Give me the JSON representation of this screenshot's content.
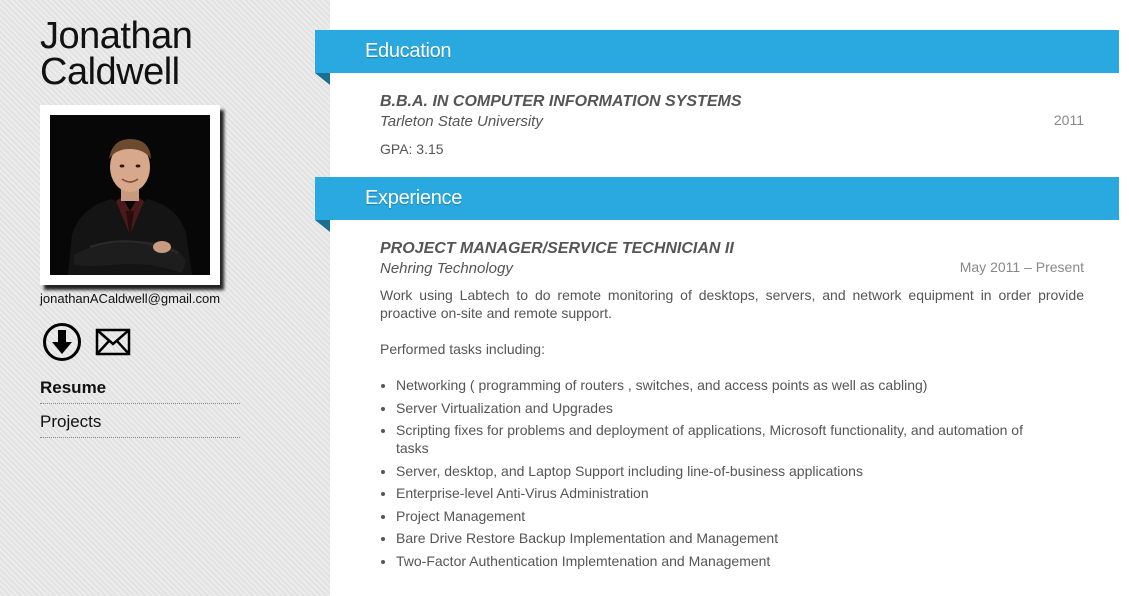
{
  "sidebar": {
    "name_first": "Jonathan",
    "name_last": "Caldwell",
    "email": "jonathanACaldwell@gmail.com",
    "icons": {
      "download": "download-icon",
      "mail": "mail-icon"
    },
    "nav": [
      {
        "label": "Resume",
        "active": true
      },
      {
        "label": "Projects",
        "active": false
      }
    ]
  },
  "education": {
    "heading": "Education",
    "degree": "B.B.A. IN COMPUTER INFORMATION SYSTEMS",
    "school": "Tarleton State University",
    "year": "2011",
    "gpa": "GPA: 3.15"
  },
  "experience": {
    "heading": "Experience",
    "title": "PROJECT MANAGER/SERVICE TECHNICIAN II",
    "company": "Nehring Technology",
    "dates": "May 2011 – Present",
    "summary": "Work using Labtech to do remote monitoring of desktops, servers, and network equipment in order provide proactive on-site and remote support.",
    "tasks_intro": "Performed tasks including:",
    "tasks": [
      "Networking ( programming of routers , switches, and access points as well as cabling)",
      "Server Virtualization and Upgrades",
      "Scripting fixes for problems and deployment of applications, Microsoft functionality, and automation of tasks",
      "Server, desktop, and Laptop Support including line-of-business applications",
      "Enterprise-level Anti-Virus Administration",
      "Project Management",
      "Bare Drive Restore Backup Implementation and Management",
      "Two-Factor Authentication Implemtenation and Management"
    ]
  },
  "colors": {
    "accent": "#29a9df",
    "accent_dark": "#1a6f93",
    "sidebar_bg": "#e6e6e6",
    "text": "#555555"
  }
}
